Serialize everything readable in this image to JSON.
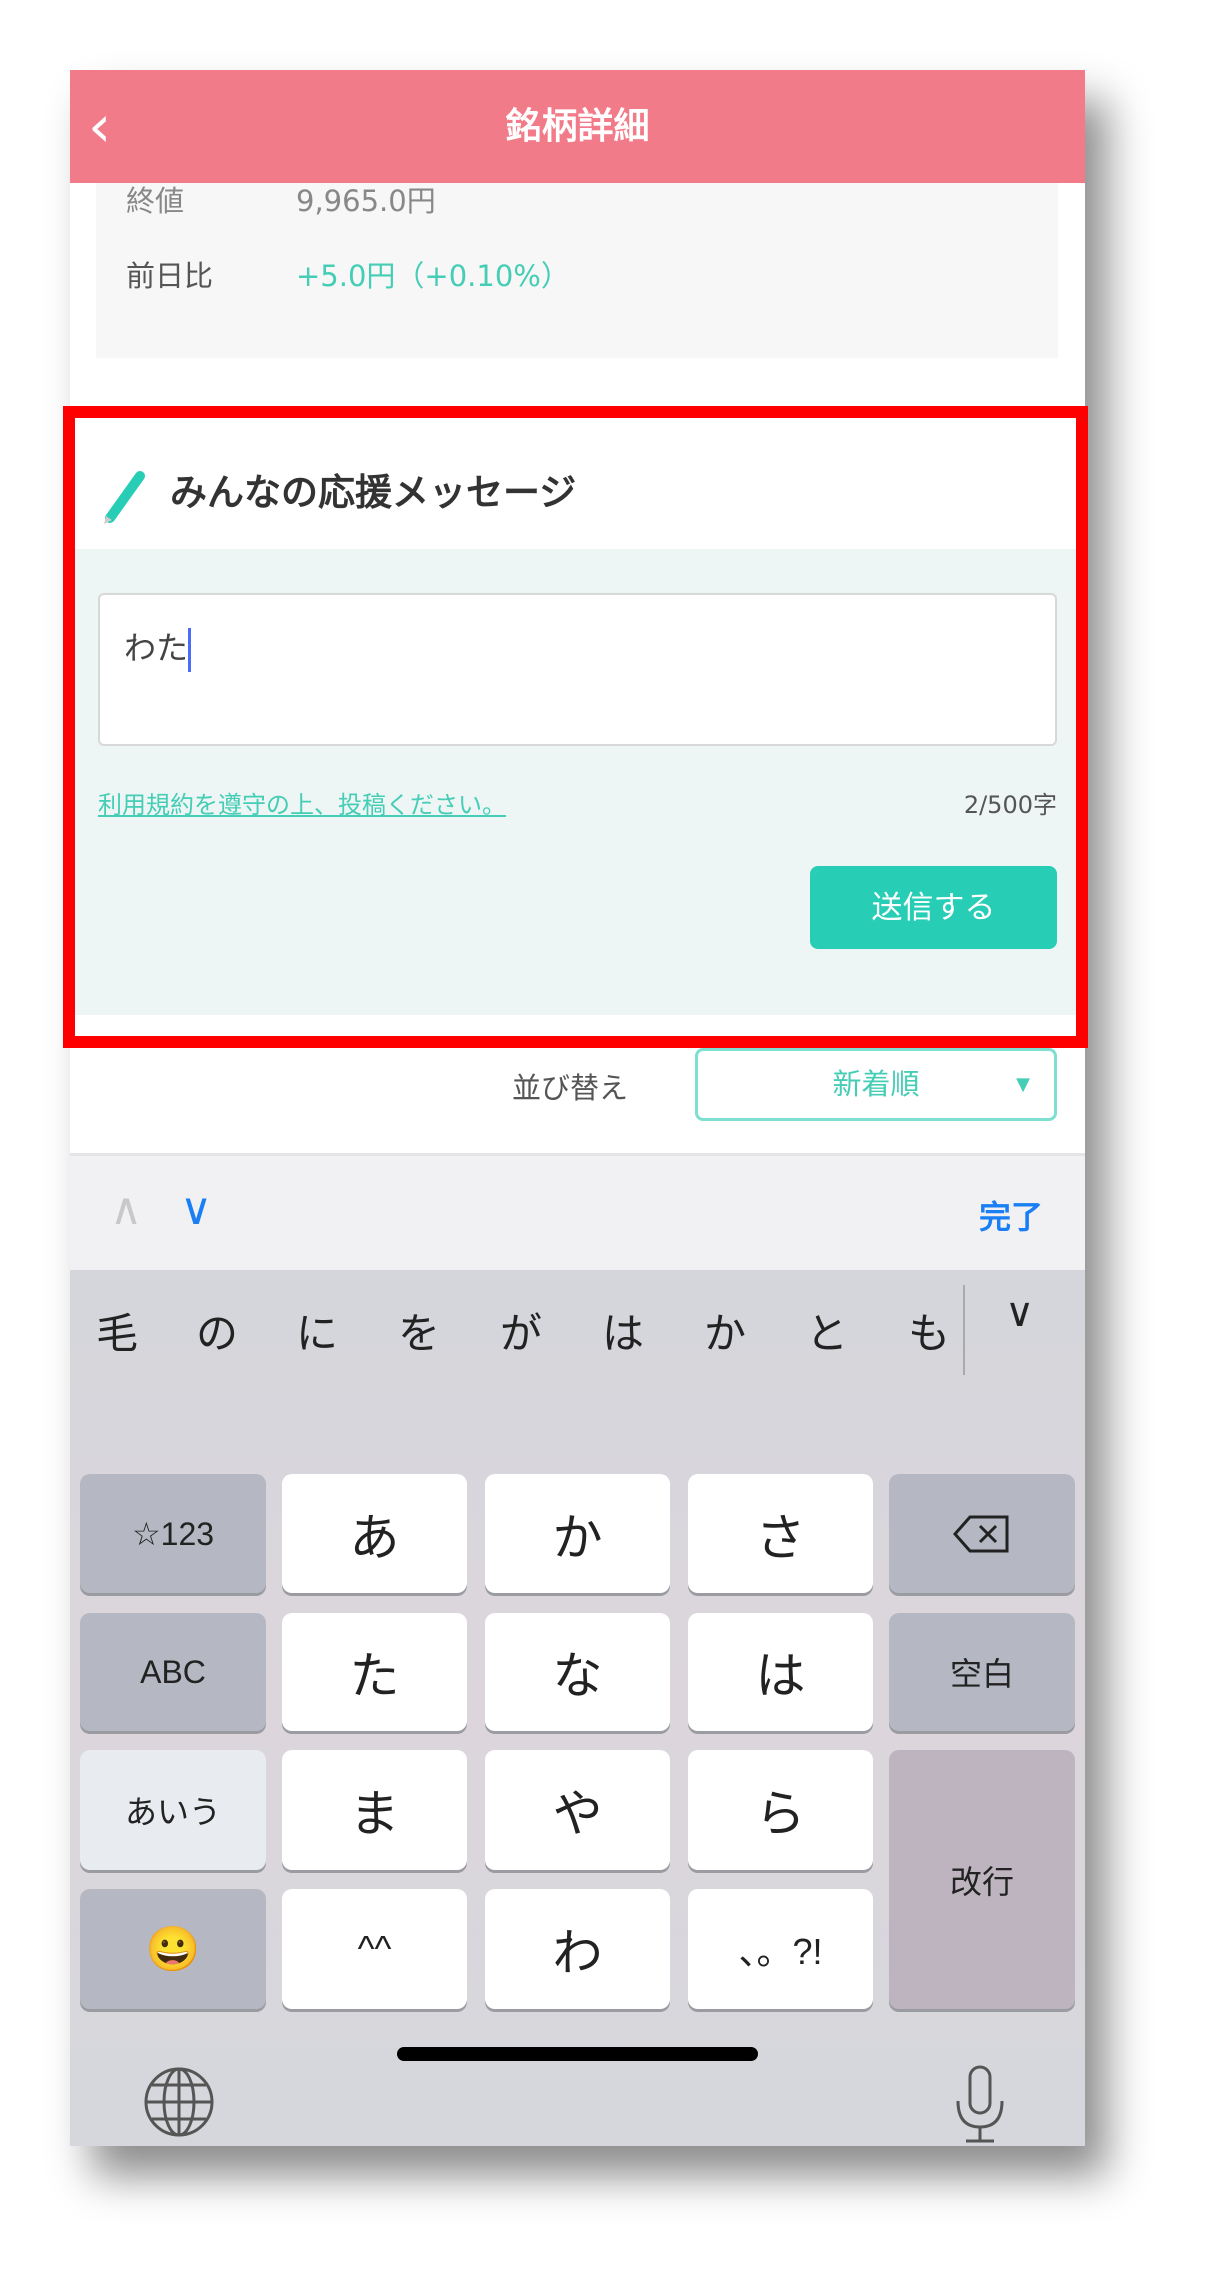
{
  "header": {
    "title": "銘柄詳細",
    "back_icon": "chevron-left-icon",
    "color": "#f27b8a"
  },
  "stock": {
    "close_label": "終値",
    "close_value": "9,965.0円",
    "change_label": "前日比",
    "change_value": "+5.0円（+0.10%）",
    "change_color": "#45cdb6"
  },
  "messages": {
    "title": "みんなの応援メッセージ",
    "icon": "pencil-icon",
    "input_value": "わた",
    "terms_link": "利用規約を遵守の上、投稿ください。",
    "counter": "2/500字",
    "send_label": "送信する",
    "accent": "#27cdb5"
  },
  "sort": {
    "label": "並び替え",
    "selected": "新着順"
  },
  "toolbar": {
    "prev_icon": "chevron-up-icon",
    "next_icon": "chevron-down-icon",
    "done_label": "完了"
  },
  "keyboard": {
    "candidates": [
      "毛",
      "の",
      "に",
      "を",
      "が",
      "は",
      "か",
      "と",
      "も"
    ],
    "keys": {
      "num": "☆123",
      "a": "あ",
      "ka": "か",
      "sa": "さ",
      "abc": "ABC",
      "ta": "た",
      "na": "な",
      "ha": "は",
      "space": "空白",
      "kana": "あいう",
      "ma": "ま",
      "ya": "や",
      "ra": "ら",
      "enter": "改行",
      "emoji": "😀",
      "kaomoji": "^^",
      "wa": "わ",
      "punct": "、。?!"
    },
    "delete_icon": "backspace-icon",
    "globe_icon": "globe-icon",
    "mic_icon": "microphone-icon"
  },
  "annotation": {
    "highlight_color": "#ff0000"
  }
}
